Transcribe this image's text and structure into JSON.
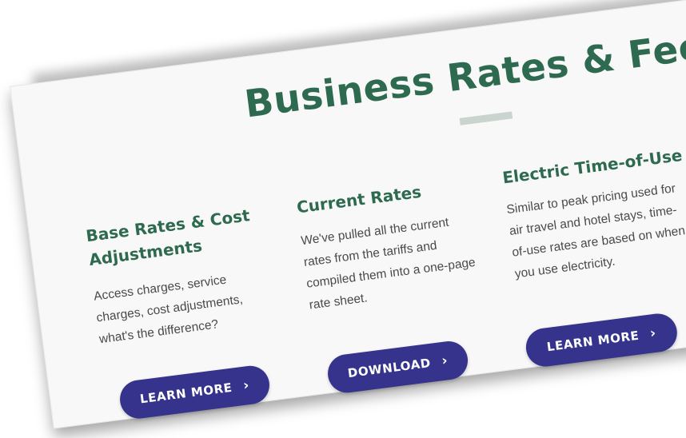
{
  "page": {
    "heading": "Business Rates & Fees"
  },
  "columns": [
    {
      "title": "Base Rates & Cost Adjustments",
      "description": "Access charges, service charges, cost adjustments, what's the difference?",
      "button_label": "LEARN MORE",
      "button_icon": "chevron-right-icon"
    },
    {
      "title": "Current Rates",
      "description": "We've pulled all the current rates from the tariffs and compiled them into a one-page rate sheet.",
      "button_label": "DOWNLOAD",
      "button_icon": "chevron-right-icon"
    },
    {
      "title": "Electric Time-of-Use",
      "description": "Similar to peak pricing used for air travel and hotel stays, time-of-use rates are based on when you use electricity.",
      "button_label": "LEARN MORE",
      "button_icon": "chevron-right-icon"
    }
  ],
  "colors": {
    "heading": "#2e6a4f",
    "button": "#35338c",
    "divider": "#c9d4cf",
    "body_text": "#4a4a4a"
  }
}
